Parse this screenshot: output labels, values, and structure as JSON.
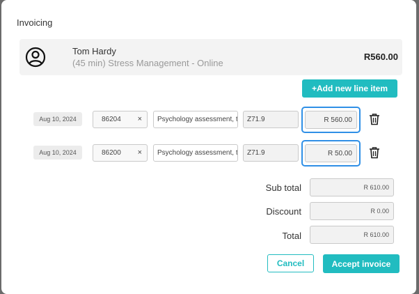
{
  "modal": {
    "title": "Invoicing"
  },
  "patient": {
    "name": "Tom Hardy",
    "service": "(45 min) Stress Management - Online",
    "amount": "R560.00",
    "avatar_icon": "user-circle-icon"
  },
  "actions": {
    "add_line_item": "+Add new line item",
    "cancel": "Cancel",
    "accept": "Accept invoice"
  },
  "line_items": [
    {
      "date": "Aug 10, 2024",
      "code": "86204",
      "clear_symbol": "×",
      "description": "Psychology assessment, treatm",
      "icd": "Z71.9",
      "amount": "R 560.00"
    },
    {
      "date": "Aug 10, 2024",
      "code": "86200",
      "clear_symbol": "×",
      "description": "Psychology assessment, treatm",
      "icd": "Z71.9",
      "amount": "R 50.00"
    }
  ],
  "summary": {
    "sub_total_label": "Sub total",
    "sub_total_value": "R 610.00",
    "discount_label": "Discount",
    "discount_value": "R 0.00",
    "total_label": "Total",
    "total_value": "R 610.00"
  },
  "colors": {
    "accent": "#21bcc0",
    "focus": "#2f8fe6"
  },
  "icons": {
    "delete": "trash-icon"
  }
}
